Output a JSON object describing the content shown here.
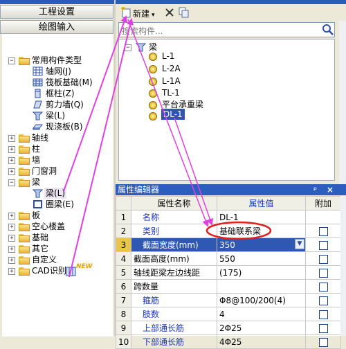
{
  "left_panel": {
    "project_settings_label": "工程设置",
    "drawing_input_label": "绘图输入",
    "expand_all_symbol": "+",
    "collapse_all_symbol": "−",
    "tree": [
      {
        "label": "常用构件类型",
        "expanded": true,
        "icon": "folder-open-icon",
        "level": 0
      },
      {
        "label": "轴网(J)",
        "icon": "axis-grid-icon",
        "level": 1
      },
      {
        "label": "筏板基础(M)",
        "icon": "raft-foundation-icon",
        "level": 1
      },
      {
        "label": "框柱(Z)",
        "icon": "frame-column-icon",
        "level": 1
      },
      {
        "label": "剪力墙(Q)",
        "icon": "shear-wall-icon",
        "level": 1
      },
      {
        "label": "梁(L)",
        "icon": "beam-icon",
        "level": 1
      },
      {
        "label": "现浇板(B)",
        "icon": "cast-slab-icon",
        "level": 1
      },
      {
        "label": "轴线",
        "icon": "folder-icon",
        "level": 0
      },
      {
        "label": "柱",
        "icon": "folder-icon",
        "level": 0
      },
      {
        "label": "墙",
        "icon": "folder-icon",
        "level": 0
      },
      {
        "label": "门窗洞",
        "icon": "folder-icon",
        "level": 0
      },
      {
        "label": "梁",
        "expanded": true,
        "icon": "folder-open-icon",
        "level": 0
      },
      {
        "label": "梁(L)",
        "icon": "beam-icon",
        "level": 1
      },
      {
        "label": "圈梁(E)",
        "icon": "ring-beam-icon",
        "level": 1
      },
      {
        "label": "板",
        "icon": "folder-icon",
        "level": 0
      },
      {
        "label": "空心楼盖",
        "icon": "folder-icon",
        "level": 0
      },
      {
        "label": "基础",
        "icon": "folder-icon",
        "level": 0
      },
      {
        "label": "其它",
        "icon": "folder-icon",
        "level": 0
      },
      {
        "label": "自定义",
        "icon": "folder-icon",
        "level": 0
      },
      {
        "label": "CAD识别",
        "icon": "folder-icon",
        "level": 0,
        "badge": "NEW"
      }
    ]
  },
  "toolbar": {
    "new_label": "新建",
    "new_arrow": "▾",
    "delete_icon": "delete-icon",
    "copy_icon": "copy-icon"
  },
  "search": {
    "placeholder": "搜索构件..."
  },
  "component_tree": {
    "root_label": "梁",
    "items": [
      "L-1",
      "L-2A",
      "L-1A",
      "TL-1",
      "平台承重梁",
      "DL-1"
    ],
    "selected": "DL-1"
  },
  "property_editor": {
    "title": "属性编辑器",
    "pin_symbol": "ᵖ",
    "close_symbol": "×",
    "columns": [
      "属性名称",
      "属性值",
      "附加"
    ],
    "rows": [
      {
        "num": "1",
        "name": "名称",
        "value": "DL-1",
        "blue": true,
        "checkbox": false
      },
      {
        "num": "2",
        "name": "类别",
        "value": "基础联系梁",
        "blue": true,
        "checkbox": true
      },
      {
        "num": "3",
        "name": "截面宽度(mm)",
        "value": "350",
        "blue": true,
        "checkbox": true,
        "selected": true
      },
      {
        "num": "4",
        "name": "截面高度(mm)",
        "value": "550",
        "blue": false,
        "checkbox": true
      },
      {
        "num": "5",
        "name": "轴线距梁左边线距",
        "value": "(175)",
        "blue": false,
        "checkbox": true
      },
      {
        "num": "6",
        "name": "跨数量",
        "value": "",
        "blue": false,
        "checkbox": true
      },
      {
        "num": "7",
        "name": "箍筋",
        "value": "Φ8@100/200(4)",
        "blue": true,
        "checkbox": true
      },
      {
        "num": "8",
        "name": "肢数",
        "value": "4",
        "blue": true,
        "checkbox": true
      },
      {
        "num": "9",
        "name": "上部通长筋",
        "value": "2Φ25",
        "blue": true,
        "checkbox": true
      },
      {
        "num": "10",
        "name": "下部通长筋",
        "value": "4Φ25",
        "blue": true,
        "checkbox": true
      }
    ]
  },
  "colors": {
    "title_bar": "#2b5ebd",
    "annotation_arrow": "#e040e0",
    "highlight_ellipse": "#e02020",
    "property_blue": "#1a34b8"
  }
}
